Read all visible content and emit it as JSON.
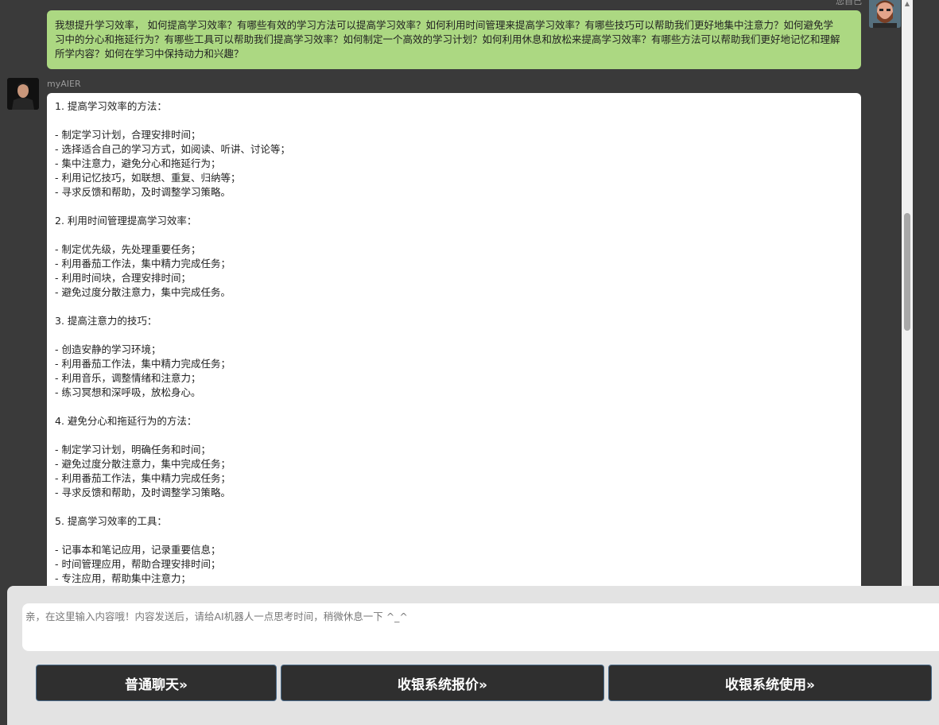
{
  "user": {
    "name": "您自己",
    "message_lines": [
      "我想提升学习效率， 如何提高学习效率？有哪些有效的学习方法可以提高学习效率？如何利用时间管理来提高学习效率？有哪些技巧可以帮助我们更好地集中注意力？如何避免学",
      "习中的分心和拖延行为？有哪些工具可以帮助我们提高学习效率？如何制定一个高效的学习计划？如何利用休息和放松来提高学习效率？有哪些方法可以帮助我们更好地记忆和理解",
      "所学内容？如何在学习中保持动力和兴趣？"
    ]
  },
  "bot": {
    "name": "myAIER",
    "lines": [
      "1. 提高学习效率的方法：",
      "",
      "- 制定学习计划，合理安排时间；",
      "- 选择适合自己的学习方式，如阅读、听讲、讨论等；",
      "- 集中注意力，避免分心和拖延行为；",
      "- 利用记忆技巧，如联想、重复、归纳等；",
      "- 寻求反馈和帮助，及时调整学习策略。",
      "",
      "2. 利用时间管理提高学习效率：",
      "",
      "- 制定优先级，先处理重要任务；",
      "- 利用番茄工作法，集中精力完成任务；",
      "- 利用时间块，合理安排时间；",
      "- 避免过度分散注意力，集中完成任务。",
      "",
      "3. 提高注意力的技巧：",
      "",
      "- 创造安静的学习环境；",
      "- 利用番茄工作法，集中精力完成任务；",
      "- 利用音乐，调整情绪和注意力；",
      "- 练习冥想和深呼吸，放松身心。",
      "",
      "4. 避免分心和拖延行为的方法：",
      "",
      "- 制定学习计划，明确任务和时间；",
      "- 避免过度分散注意力，集中完成任务；",
      "- 利用番茄工作法，集中精力完成任务；",
      "- 寻求反馈和帮助，及时调整学习策略。",
      "",
      "5. 提高学习效率的工具：",
      "",
      "- 记事本和笔记应用，记录重要信息；",
      "- 时间管理应用，帮助合理安排时间；",
      "- 专注应用，帮助集中注意力；"
    ]
  },
  "input": {
    "placeholder": "亲，在这里输入内容哦！内容发送后，请给AI机器人一点思考时间，稍微休息一下 ^_^",
    "value": ""
  },
  "buttons": {
    "chat": "普通聊天»",
    "cashier_quote": "收银系统报价»",
    "cashier_use": "收银系统使用»"
  },
  "colors": {
    "background": "#3a3a3a",
    "user_bubble": "#acd882",
    "bot_bubble": "#ffffff",
    "button_bg": "#2f2f2f",
    "button_border": "#4a6b8a"
  }
}
